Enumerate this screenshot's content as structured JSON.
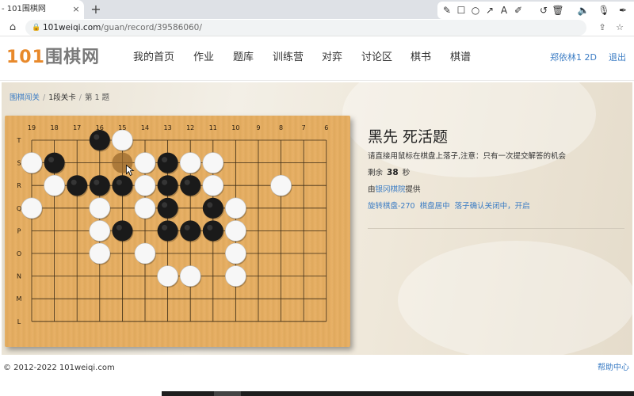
{
  "browser": {
    "tab_title": "- 101围棋网",
    "tab_close": "×",
    "new_tab": "+",
    "url_domain": "101weiqi.com",
    "url_path": "/guan/record/39586060/",
    "lock_icon": "🔒"
  },
  "annotation_tools": [
    "pen-icon",
    "rectangle-icon",
    "circle-icon",
    "arrow-icon",
    "text-icon",
    "highlighter-icon",
    "undo-icon",
    "trash-icon",
    "speaker-icon",
    "microphone-icon",
    "pen-alt-icon"
  ],
  "site": {
    "logo_number": "101",
    "logo_text": "围棋网",
    "nav": [
      "我的首页",
      "作业",
      "题库",
      "训练营",
      "对弈",
      "讨论区",
      "棋书",
      "棋谱"
    ],
    "user": "郑依林1 2D",
    "logout": "退出"
  },
  "breadcrumb": {
    "root": "围棋闯关",
    "level": "1段关卡",
    "current": "第 1 题",
    "sep": "/"
  },
  "problem": {
    "title": "黑先 死活题",
    "instruction": "请直接用鼠标在棋盘上落子,注意：只有一次提交解答的机会",
    "timer_prefix": "剩余",
    "timer_value": "38",
    "timer_unit": "秒",
    "provider_prefix": "由",
    "provider_name": "银冈棋院",
    "provider_suffix": "提供",
    "action_rotate": "旋转棋盘-270",
    "action_center": "棋盘居中",
    "action_confirm": "落子确认关闭中，开启"
  },
  "board": {
    "col_labels": [
      "19",
      "18",
      "17",
      "16",
      "15",
      "14",
      "13",
      "12",
      "11",
      "10",
      "9",
      "8",
      "7",
      "6"
    ],
    "row_labels": [
      "T",
      "S",
      "R",
      "Q",
      "P",
      "O",
      "N",
      "M",
      "L"
    ],
    "black_stones": [
      [
        3,
        0
      ],
      [
        1,
        1
      ],
      [
        6,
        1
      ],
      [
        2,
        2
      ],
      [
        3,
        2
      ],
      [
        4,
        2
      ],
      [
        6,
        2
      ],
      [
        7,
        2
      ],
      [
        6,
        3
      ],
      [
        8,
        3
      ],
      [
        4,
        4
      ],
      [
        6,
        4
      ],
      [
        7,
        4
      ],
      [
        8,
        4
      ]
    ],
    "white_stones": [
      [
        4,
        0
      ],
      [
        0,
        1
      ],
      [
        5,
        1
      ],
      [
        7,
        1
      ],
      [
        8,
        1
      ],
      [
        1,
        2
      ],
      [
        5,
        2
      ],
      [
        8,
        2
      ],
      [
        11,
        2
      ],
      [
        0,
        3
      ],
      [
        3,
        3
      ],
      [
        5,
        3
      ],
      [
        9,
        3
      ],
      [
        3,
        4
      ],
      [
        9,
        4
      ],
      [
        3,
        5
      ],
      [
        5,
        5
      ],
      [
        9,
        5
      ],
      [
        6,
        6
      ],
      [
        7,
        6
      ],
      [
        9,
        6
      ]
    ],
    "hover_point": [
      4,
      1
    ],
    "colors": {
      "wood": "#e6ad5f",
      "line": "#3a2a14",
      "black": "#1a1a1a",
      "white": "#f7f7f7",
      "hover": "#9a6a2e"
    }
  },
  "footer": {
    "copyright": "© 2012-2022 101weiqi.com",
    "help": "帮助中心"
  }
}
